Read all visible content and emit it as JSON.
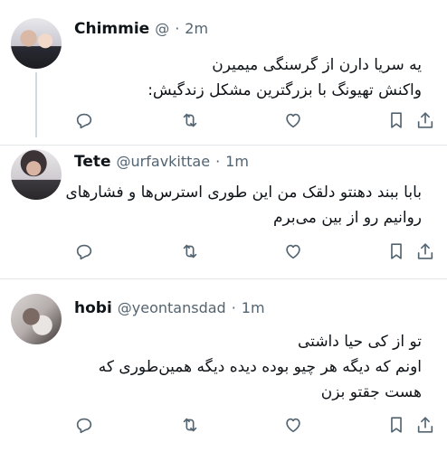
{
  "tweets": [
    {
      "name": "Chimmie",
      "handle": "@",
      "sep": "·",
      "time": "2m",
      "lines": [
        "یه سریا دارن از گرسنگی میمیرن",
        "واکنش تهیونگ با بزرگترین مشکل زندگیش:"
      ]
    },
    {
      "name": "Tete",
      "handle": "@urfavkittae",
      "sep": "·",
      "time": "1m",
      "lines": [
        "بابا ببند دهنتو دلقک من این طوری استرس‌ها و فشارهای",
        "روانیم رو از بین می‌برم"
      ]
    },
    {
      "name": "hobi",
      "handle": "@yeontansdad",
      "sep": "·",
      "time": "1m",
      "lines": [
        "تو از کی حیا داشتی",
        "اونم که دیگه هر چیو بوده دیده دیگه همین‌طوری که",
        "هست جقتو بزن"
      ]
    }
  ],
  "icons": [
    "reply-icon",
    "retweet-icon",
    "like-icon",
    "bookmark-icon",
    "share-icon"
  ],
  "colors": {
    "text": "#0f1419",
    "secondary": "#536471",
    "thread_line": "#cfd9de",
    "divider": "#e3e7ea"
  }
}
